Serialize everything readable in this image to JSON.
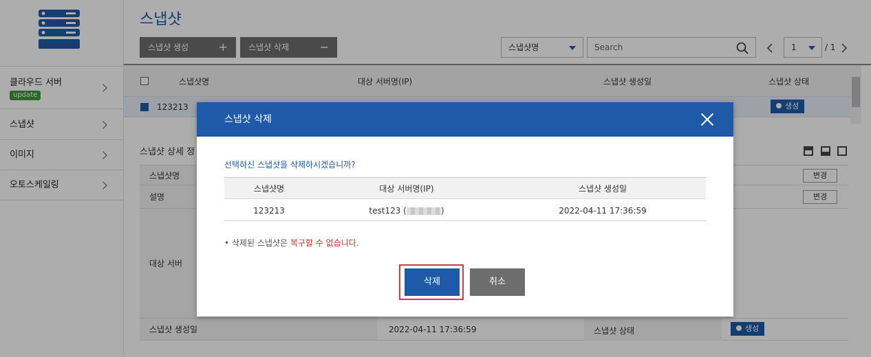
{
  "page": {
    "title": "스냅샷"
  },
  "sidebar": {
    "items": [
      {
        "label": "클라우드 서버",
        "badge": "update"
      },
      {
        "label": "스냅샷"
      },
      {
        "label": "이미지"
      },
      {
        "label": "오토스케일링"
      }
    ]
  },
  "toolbar": {
    "create_label": "스냅샷 생성",
    "create_sign": "+",
    "delete_label": "스냅샷 삭제",
    "delete_sign": "−",
    "filter_value": "스냅샷명",
    "search_placeholder": "Search",
    "page_current": "1",
    "page_total": "/ 1"
  },
  "list": {
    "headers": [
      "스냅샷명",
      "대상 서버명(IP)",
      "스냅샷 생성일",
      "스냅샷 상태"
    ],
    "rows": [
      {
        "name": "123213",
        "status": "생성"
      }
    ]
  },
  "detail": {
    "title": "스냅샷 상세 정",
    "rows": [
      {
        "label": "스냅샷명",
        "button": "변경"
      },
      {
        "label": "설명",
        "button": "변경"
      },
      {
        "label": "대상 서버"
      },
      {
        "label": "스냅샷 생성일",
        "value": "2022-04-11 17:36:59",
        "label2": "스냅샷 상태",
        "status": "생성"
      }
    ]
  },
  "modal": {
    "title": "스냅샷 삭제",
    "question": "선택하신 스냅샷을 삭제하시겠습니까?",
    "headers": [
      "스냅샷명",
      "대상 서버명(IP)",
      "스냅샷 생성일"
    ],
    "row": {
      "name": "123213",
      "server": "test123 (",
      "server_suffix": ")",
      "created": "2022-04-11 17:36:59"
    },
    "warning_prefix": "• 삭제된 스냅샷은 ",
    "warning_emph": "복구할 수 없습니다.",
    "delete_label": "삭제",
    "cancel_label": "취소"
  }
}
